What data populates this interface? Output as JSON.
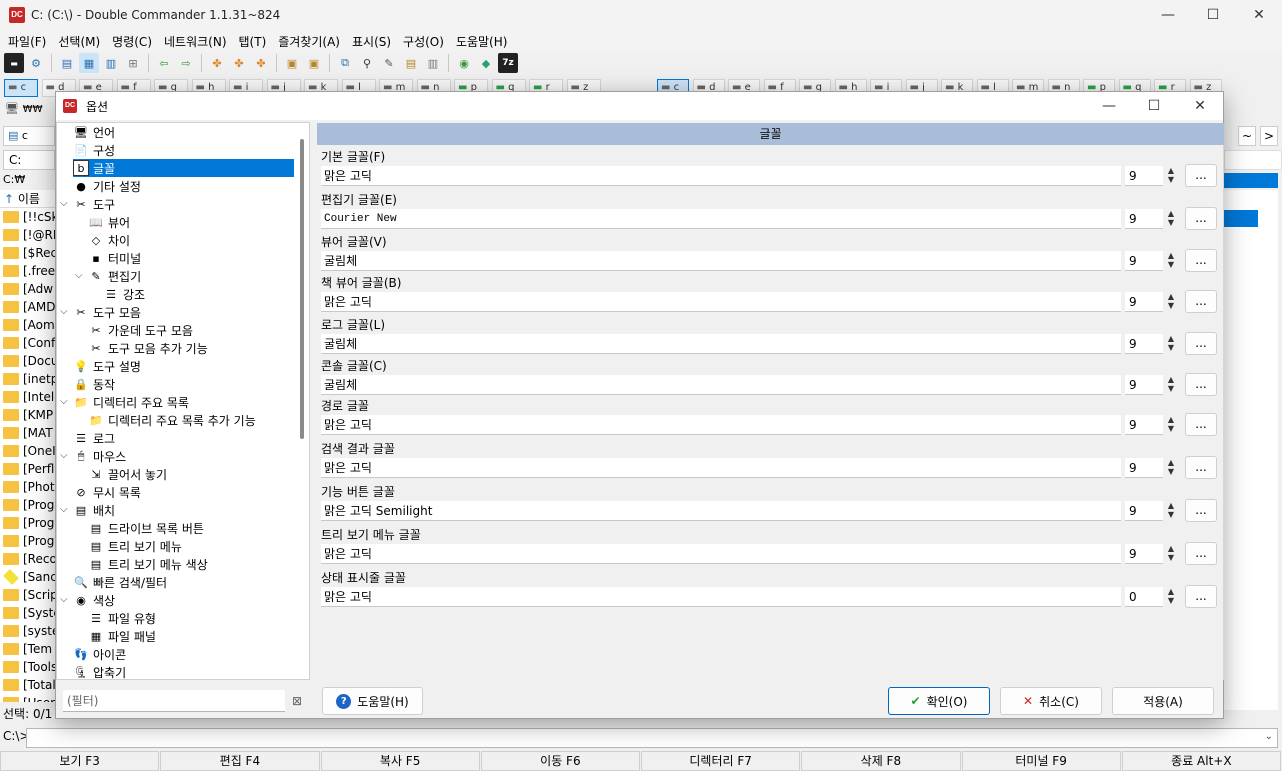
{
  "window": {
    "title": "C: (C:\\) - Double Commander 1.1.31~824",
    "icon": "DC",
    "minimize": "—",
    "maximize": "☐",
    "close": "✕"
  },
  "menu": [
    "파일(F)",
    "선택(M)",
    "명령(C)",
    "네트워크(N)",
    "탭(T)",
    "즐겨찾기(A)",
    "표시(S)",
    "구성(O)",
    "도움말(H)"
  ],
  "drives_left": [
    "c",
    "d",
    "e",
    "f",
    "g",
    "h",
    "i",
    "j",
    "k",
    "l",
    "m",
    "n",
    "p",
    "q",
    "r",
    "z"
  ],
  "drives_right": [
    "c",
    "d",
    "e",
    "f",
    "g",
    "h",
    "i",
    "j",
    "k",
    "l",
    "m",
    "n",
    "p",
    "q",
    "r",
    "z"
  ],
  "left_panel": {
    "root_button": "₩₩",
    "tab": "c",
    "drive": "C:",
    "path": "C:₩",
    "col_name": "이름",
    "files": [
      "[!!cSk",
      "[!@RI",
      "[$Rec",
      "[.free",
      "[Adw",
      "[AMD",
      "[Aom",
      "[Conf",
      "[Docu",
      "[inetp",
      "[Intel",
      "[KMP",
      "[MAT",
      "[OneI",
      "[Perfl",
      "[Phot",
      "[Prog",
      "[Prog",
      "[Prog",
      "[Reco",
      "[Sanc",
      "[Scrip",
      "[Syste",
      "[syste",
      "[Tem",
      "[Tools",
      "[Total",
      "[User"
    ],
    "status": "선택: 0/1"
  },
  "right_panel": {
    "nav_back": "~",
    "nav_forward": ">"
  },
  "cmdline": {
    "prompt": "C:\\>"
  },
  "fkeys": [
    "보기 F3",
    "편집 F4",
    "복사 F5",
    "이동 F6",
    "디렉터리 F7",
    "삭제 F8",
    "터미널 F9",
    "종료 Alt+X"
  ],
  "dialog": {
    "title": "옵션",
    "tree": [
      {
        "label": "언어",
        "level": 0,
        "icon": "language-icon",
        "glyph": "🖥"
      },
      {
        "label": "구성",
        "level": 0,
        "icon": "config-icon",
        "glyph": "📄"
      },
      {
        "label": "글꼴",
        "level": 0,
        "icon": "font-icon",
        "glyph": "b",
        "selected": true
      },
      {
        "label": "기타 설정",
        "level": 0,
        "icon": "misc-icon",
        "glyph": "●"
      },
      {
        "label": "도구",
        "level": 0,
        "icon": "tools-icon",
        "glyph": "✂",
        "expanded": true
      },
      {
        "label": "뷰어",
        "level": 1,
        "icon": "viewer-icon",
        "glyph": "📖"
      },
      {
        "label": "차이",
        "level": 1,
        "icon": "diff-icon",
        "glyph": "◇"
      },
      {
        "label": "터미널",
        "level": 1,
        "icon": "terminal-icon",
        "glyph": "▪"
      },
      {
        "label": "편집기",
        "level": 1,
        "icon": "editor-icon",
        "glyph": "✎",
        "expanded": true
      },
      {
        "label": "강조",
        "level": 2,
        "icon": "highlight-icon",
        "glyph": "☰"
      },
      {
        "label": "도구 모음",
        "level": 0,
        "icon": "toolbar-icon",
        "glyph": "✂",
        "expanded": true
      },
      {
        "label": "가운데 도구 모음",
        "level": 1,
        "icon": "middle-toolbar-icon",
        "glyph": "✂"
      },
      {
        "label": "도구 모음 추가 기능",
        "level": 1,
        "icon": "toolbar-extra-icon",
        "glyph": "✂"
      },
      {
        "label": "도구 설명",
        "level": 0,
        "icon": "tooltip-icon",
        "glyph": "💡"
      },
      {
        "label": "동작",
        "level": 0,
        "icon": "behavior-icon",
        "glyph": "🔒"
      },
      {
        "label": "디렉터리 주요 목록",
        "level": 0,
        "icon": "hotlist-icon",
        "glyph": "📁",
        "expanded": true
      },
      {
        "label": "디렉터리 주요 목록 추가 기능",
        "level": 1,
        "icon": "hotlist-extra-icon",
        "glyph": "📁"
      },
      {
        "label": "로그",
        "level": 0,
        "icon": "log-icon",
        "glyph": "☰"
      },
      {
        "label": "마우스",
        "level": 0,
        "icon": "mouse-icon",
        "glyph": "🖱",
        "expanded": true
      },
      {
        "label": "끌어서 놓기",
        "level": 1,
        "icon": "drag-drop-icon",
        "glyph": "⇲"
      },
      {
        "label": "무시 목록",
        "level": 0,
        "icon": "ignore-list-icon",
        "glyph": "⊘"
      },
      {
        "label": "배치",
        "level": 0,
        "icon": "layout-icon",
        "glyph": "▤",
        "expanded": true
      },
      {
        "label": "드라이브 목록 버튼",
        "level": 1,
        "icon": "drive-list-button-icon",
        "glyph": "▤"
      },
      {
        "label": "트리 보기 메뉴",
        "level": 1,
        "icon": "tree-view-menu-icon",
        "glyph": "▤"
      },
      {
        "label": "트리 보기 메뉴 색상",
        "level": 1,
        "icon": "tree-view-menu-color-icon",
        "glyph": "▤"
      },
      {
        "label": "빠른 검색/필터",
        "level": 0,
        "icon": "quick-search-icon",
        "glyph": "🔍"
      },
      {
        "label": "색상",
        "level": 0,
        "icon": "colors-icon",
        "glyph": "◉",
        "expanded": true
      },
      {
        "label": "파일 유형",
        "level": 1,
        "icon": "file-types-icon",
        "glyph": "☰"
      },
      {
        "label": "파일 패널",
        "level": 1,
        "icon": "file-panels-icon",
        "glyph": "▦"
      },
      {
        "label": "아이콘",
        "level": 0,
        "icon": "icons-icon",
        "glyph": "👣"
      },
      {
        "label": "압축기",
        "level": 0,
        "icon": "archiver-icon",
        "glyph": "🗜"
      }
    ],
    "panel_title": "글꼴",
    "fonts": [
      {
        "label": "기본 글꼴(F)",
        "value": "맑은 고딕",
        "size": "9"
      },
      {
        "label": "편집기 글꼴(E)",
        "value": "Courier New",
        "size": "9",
        "mono": true
      },
      {
        "label": "뷰어 글꼴(V)",
        "value": "굴림체",
        "size": "9"
      },
      {
        "label": "책 뷰어 글꼴(B)",
        "value": "맑은 고딕",
        "size": "9"
      },
      {
        "label": "로그 글꼴(L)",
        "value": "굴림체",
        "size": "9"
      },
      {
        "label": "콘솔 글꼴(C)",
        "value": "굴림체",
        "size": "9"
      },
      {
        "label": "경로 글꼴",
        "value": "맑은 고딕",
        "size": "9"
      },
      {
        "label": "검색 결과 글꼴",
        "value": "맑은 고딕",
        "size": "9"
      },
      {
        "label": "기능 버튼 글꼴",
        "value": "맑은 고딕 Semilight",
        "size": "9"
      },
      {
        "label": "트리 보기 메뉴 글꼴",
        "value": "맑은 고딕",
        "size": "9"
      },
      {
        "label": "상태 표시줄 글꼴",
        "value": "맑은 고딕",
        "size": "0"
      }
    ],
    "browse_label": "...",
    "filter_placeholder": "(필터)",
    "help_button": "도움말(H)",
    "ok_button": "확인(O)",
    "cancel_button": "취소(C)",
    "apply_button": "적용(A)"
  }
}
